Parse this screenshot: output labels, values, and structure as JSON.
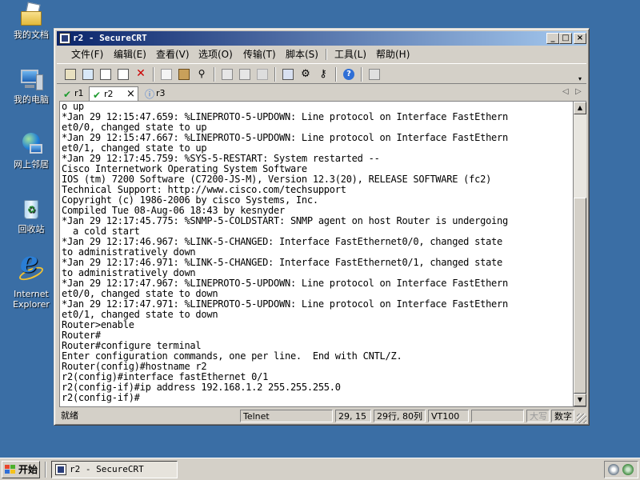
{
  "desktop": {
    "icons": [
      {
        "label": "我的文档",
        "icon": "my-documents-icon"
      },
      {
        "label": "我的电脑",
        "icon": "my-computer-icon"
      },
      {
        "label": "网上邻居",
        "icon": "network-places-icon"
      },
      {
        "label": "回收站",
        "icon": "recycle-bin-icon"
      },
      {
        "label_line1": "Internet",
        "label_line2": "Explorer",
        "icon": "internet-explorer-icon"
      }
    ]
  },
  "window": {
    "title": "r2 - SecureCRT",
    "controls": {
      "minimize": "_",
      "maximize": "□",
      "close": "×"
    },
    "menu": [
      "文件(F)",
      "编辑(E)",
      "查看(V)",
      "选项(O)",
      "传输(T)",
      "脚本(S)",
      "工具(L)",
      "帮助(H)"
    ],
    "tabs": [
      {
        "label": "r1",
        "status_icon": "check-icon",
        "active": false
      },
      {
        "label": "r2",
        "status_icon": "check-icon",
        "active": true,
        "close": "×"
      },
      {
        "label": "r3",
        "status_icon": "info-icon",
        "active": false
      }
    ],
    "tab_nav": {
      "left": "◁",
      "right": "▷"
    },
    "terminal_lines": [
      "o up",
      "*Jan 29 12:15:47.659: %LINEPROTO-5-UPDOWN: Line protocol on Interface FastEthern",
      "et0/0, changed state to up",
      "*Jan 29 12:15:47.667: %LINEPROTO-5-UPDOWN: Line protocol on Interface FastEthern",
      "et0/1, changed state to up",
      "*Jan 29 12:17:45.759: %SYS-5-RESTART: System restarted --",
      "Cisco Internetwork Operating System Software",
      "IOS (tm) 7200 Software (C7200-JS-M), Version 12.3(20), RELEASE SOFTWARE (fc2)",
      "Technical Support: http://www.cisco.com/techsupport",
      "Copyright (c) 1986-2006 by cisco Systems, Inc.",
      "Compiled Tue 08-Aug-06 18:43 by kesnyder",
      "*Jan 29 12:17:45.775: %SNMP-5-COLDSTART: SNMP agent on host Router is undergoing",
      "  a cold start",
      "*Jan 29 12:17:46.967: %LINK-5-CHANGED: Interface FastEthernet0/0, changed state",
      "to administratively down",
      "*Jan 29 12:17:46.971: %LINK-5-CHANGED: Interface FastEthernet0/1, changed state",
      "to administratively down",
      "*Jan 29 12:17:47.967: %LINEPROTO-5-UPDOWN: Line protocol on Interface FastEthern",
      "et0/0, changed state to down",
      "*Jan 29 12:17:47.971: %LINEPROTO-5-UPDOWN: Line protocol on Interface FastEthern",
      "et0/1, changed state to down",
      "Router>enable",
      "Router#",
      "Router#configure terminal",
      "Enter configuration commands, one per line.  End with CNTL/Z.",
      "Router(config)#hostname r2",
      "r2(config)#interface fastEthernet 0/1",
      "r2(config-if)#ip address 192.168.1.2 255.255.255.0",
      "r2(config-if)#"
    ],
    "status": {
      "ready": "就绪",
      "protocol": "Telnet",
      "cursor": "29, 15",
      "size": "29行, 80列",
      "emulation": "VT100",
      "blank": "",
      "caps": "大写",
      "num": "数字"
    }
  },
  "taskbar": {
    "start": "开始",
    "task": "r2 - SecureCRT"
  },
  "colors": {
    "desktop": "#3a6ea5",
    "titlebar_start": "#0a246a",
    "titlebar_end": "#a6caf0",
    "chrome": "#d4d0c8"
  }
}
